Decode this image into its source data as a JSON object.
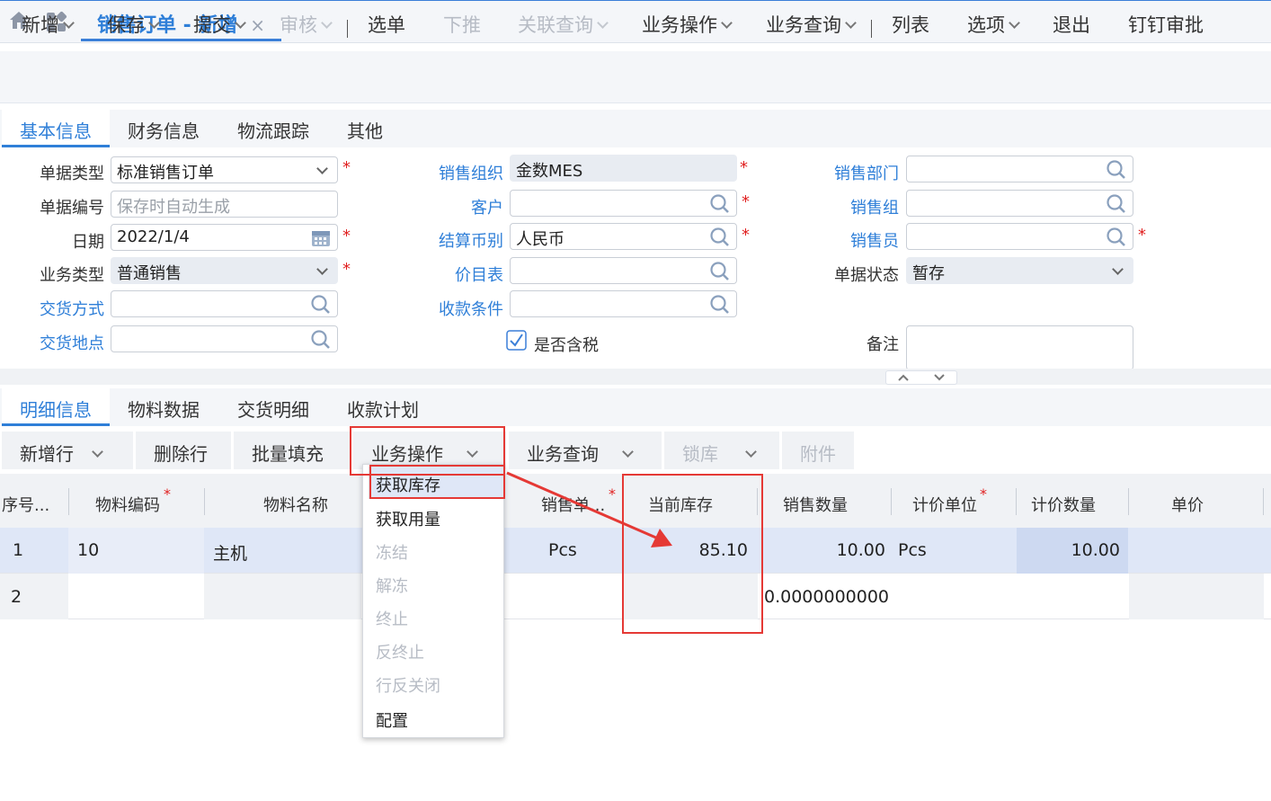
{
  "app": {
    "page_tab": "销售订单 - 新增",
    "close_glyph": "×"
  },
  "toolbar": {
    "items": [
      "新增",
      "保存",
      "提交",
      "审核",
      "选单",
      "下推",
      "关联查询",
      "业务操作",
      "业务查询",
      "列表",
      "选项",
      "退出",
      "钉钉审批"
    ]
  },
  "header_tabs": [
    "基本信息",
    "财务信息",
    "物流跟踪",
    "其他"
  ],
  "form": {
    "doc_type": {
      "label": "单据类型",
      "value": "标准销售订单"
    },
    "doc_no": {
      "label": "单据编号",
      "placeholder": "保存时自动生成"
    },
    "date": {
      "label": "日期",
      "value": "2022/1/4"
    },
    "biz_type": {
      "label": "业务类型",
      "value": "普通销售"
    },
    "delivery_method": {
      "label": "交货方式",
      "value": ""
    },
    "delivery_place": {
      "label": "交货地点",
      "value": ""
    },
    "sales_org": {
      "label": "销售组织",
      "value": "金数MES"
    },
    "customer": {
      "label": "客户",
      "value": ""
    },
    "currency": {
      "label": "结算币别",
      "value": "人民币"
    },
    "price_list": {
      "label": "价目表",
      "value": ""
    },
    "payment_terms": {
      "label": "收款条件",
      "value": ""
    },
    "tax_included": {
      "label": "是否含税",
      "checked": true
    },
    "sales_dept": {
      "label": "销售部门",
      "value": ""
    },
    "sales_group": {
      "label": "销售组",
      "value": ""
    },
    "salesman": {
      "label": "销售员",
      "value": ""
    },
    "doc_status": {
      "label": "单据状态",
      "value": "暂存"
    },
    "remark": {
      "label": "备注",
      "value": ""
    },
    "required_mark": "*"
  },
  "detail_tabs": [
    "明细信息",
    "物料数据",
    "交货明细",
    "收款计划"
  ],
  "detail_toolbar": {
    "add_row": "新增行",
    "delete_row": "删除行",
    "batch_fill": "批量填充",
    "biz_ops": "业务操作",
    "biz_query": "业务查询",
    "lock_stock": "锁库",
    "attachment": "附件"
  },
  "grid": {
    "headers": [
      "序号...",
      "物料编码",
      "物料名称",
      "销售单...",
      "当前库存",
      "销售数量",
      "计价单位",
      "计价数量",
      "单价"
    ],
    "rows": [
      {
        "seq": "1",
        "code": "10",
        "name": "主机",
        "unit": "Pcs",
        "stock": "85.10",
        "qty": "10.00",
        "price_unit": "Pcs",
        "price_qty": "10.00",
        "price": ""
      },
      {
        "seq": "2",
        "code": "",
        "name": "",
        "unit": "",
        "stock": "",
        "qty": "0.0000000000",
        "price_unit": "",
        "price_qty": "",
        "price": ""
      }
    ]
  },
  "menu": {
    "items": [
      {
        "label": "获取库存",
        "enabled": true,
        "selected": true
      },
      {
        "label": "获取用量",
        "enabled": true
      },
      {
        "label": "冻结",
        "enabled": false
      },
      {
        "label": "解冻",
        "enabled": false
      },
      {
        "label": "终止",
        "enabled": false
      },
      {
        "label": "反终止",
        "enabled": false
      },
      {
        "label": "行反关闭",
        "enabled": false
      },
      {
        "label": "配置",
        "enabled": true
      }
    ]
  },
  "colors": {
    "accent": "#2f7fd8",
    "annotation_red": "#e53935",
    "required": "#e02020",
    "selected_row": "#dfe7f7"
  }
}
